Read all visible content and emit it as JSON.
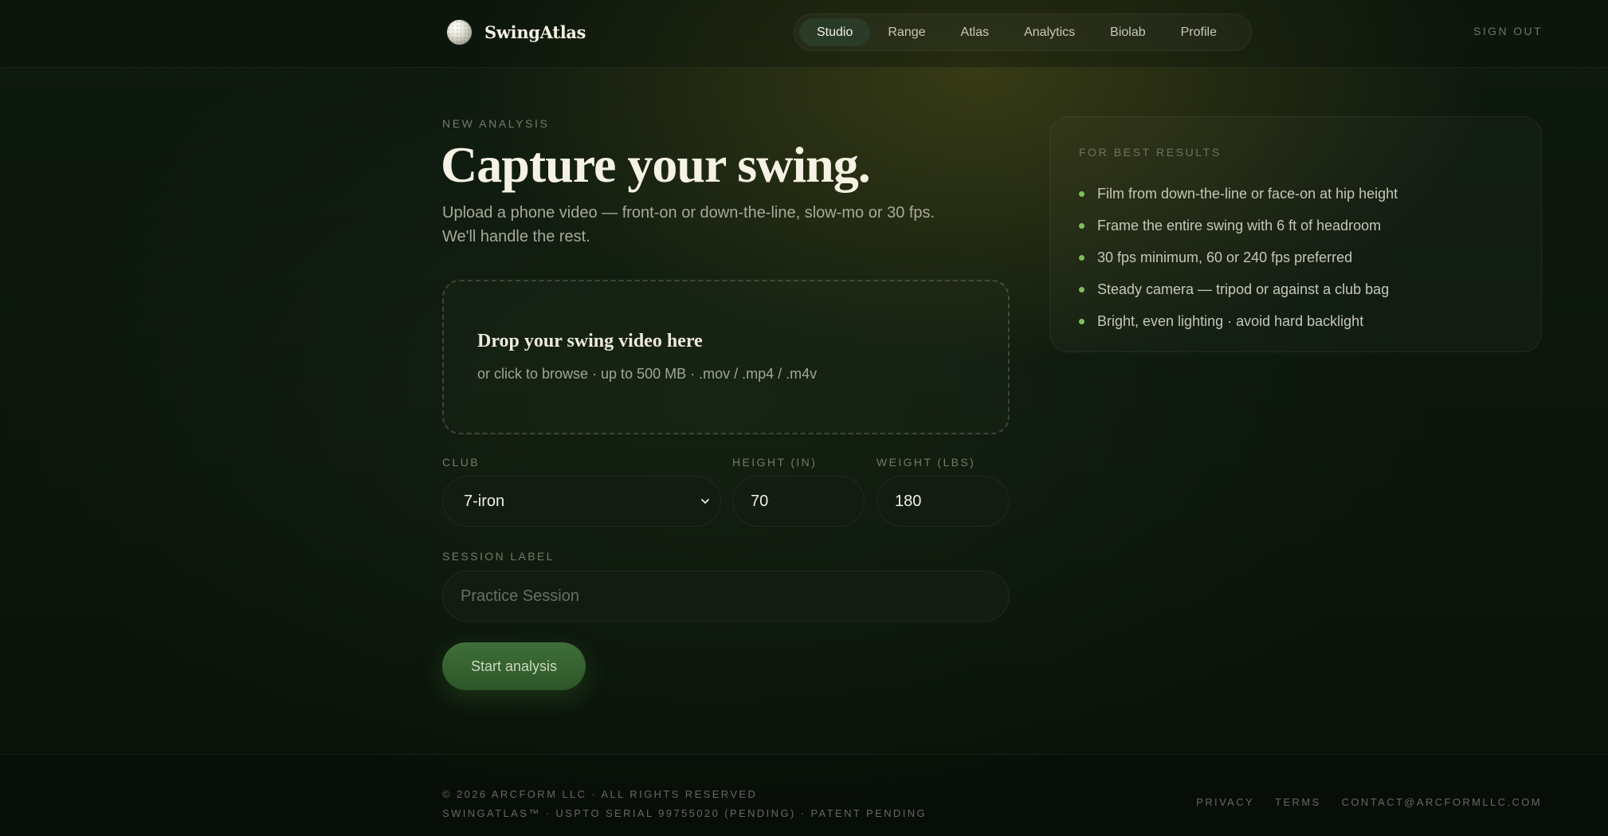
{
  "brand": {
    "name": "SwingAtlas",
    "logo_icon": "golf-ball-icon"
  },
  "nav": {
    "items": [
      {
        "label": "Studio",
        "active": true
      },
      {
        "label": "Range",
        "active": false
      },
      {
        "label": "Atlas",
        "active": false
      },
      {
        "label": "Analytics",
        "active": false
      },
      {
        "label": "Biolab",
        "active": false
      },
      {
        "label": "Profile",
        "active": false
      }
    ],
    "sign_out": "SIGN OUT"
  },
  "hero": {
    "eyebrow": "NEW ANALYSIS",
    "title": "Capture your swing.",
    "subtitle": "Upload a phone video — front-on or down-the-line, slow-mo or 30 fps. We'll handle the rest."
  },
  "dropzone": {
    "title": "Drop your swing video here",
    "subtitle": "or click to browse · up to 500 MB · .mov / .mp4 / .m4v"
  },
  "form": {
    "club": {
      "label": "CLUB",
      "value": "7-iron",
      "icon": "chevron-down-icon"
    },
    "height": {
      "label": "HEIGHT (IN)",
      "value": "70"
    },
    "weight": {
      "label": "WEIGHT (LBS)",
      "value": "180"
    },
    "session": {
      "label": "SESSION LABEL",
      "placeholder": "Practice Session",
      "value": ""
    },
    "submit": "Start analysis"
  },
  "tips": {
    "title": "FOR BEST RESULTS",
    "items": [
      "Film from down-the-line or face-on at hip height",
      "Frame the entire swing with 6 ft of headroom",
      "30 fps minimum, 60 or 240 fps preferred",
      "Steady camera — tripod or against a club bag",
      "Bright, even lighting · avoid hard backlight"
    ]
  },
  "footer": {
    "copyright": "© 2026 ARCFORM LLC · ALL RIGHTS RESERVED",
    "patent": "SWINGATLAS™ · USPTO SERIAL 99755020 (PENDING) · PATENT PENDING",
    "links": [
      "PRIVACY",
      "TERMS",
      "CONTACT@ARCFORMLLC.COM"
    ]
  },
  "colors": {
    "accent": "#7fbf5e",
    "button": "#3f6f38",
    "background": "#0f1a0f",
    "active_nav": "#2a3b27"
  }
}
